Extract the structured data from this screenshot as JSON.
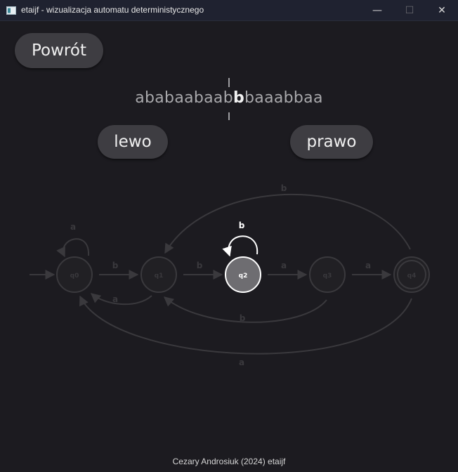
{
  "window": {
    "title": "etaijf - wizualizacja automatu deterministycznego",
    "minimize_glyph": "—",
    "maximize_glyph": "☐",
    "close_glyph": "✕"
  },
  "toolbar": {
    "back_label": "Powrót",
    "left_label": "lewo",
    "right_label": "prawo"
  },
  "tape": {
    "before": "ababaabaab",
    "current": "b",
    "after": "baaabbaa"
  },
  "automaton": {
    "states": [
      "q0",
      "q1",
      "q2",
      "q3",
      "q4"
    ],
    "current_state": "q2",
    "accepting_states": [
      "q4"
    ],
    "start_state": "q0",
    "transitions": [
      {
        "from": "q0",
        "to": "q0",
        "symbol": "a"
      },
      {
        "from": "q0",
        "to": "q1",
        "symbol": "b"
      },
      {
        "from": "q1",
        "to": "q0",
        "symbol": "a"
      },
      {
        "from": "q1",
        "to": "q2",
        "symbol": "b"
      },
      {
        "from": "q2",
        "to": "q2",
        "symbol": "b"
      },
      {
        "from": "q2",
        "to": "q3",
        "symbol": "a"
      },
      {
        "from": "q3",
        "to": "q1",
        "symbol": "b"
      },
      {
        "from": "q3",
        "to": "q4",
        "symbol": "a"
      },
      {
        "from": "q4",
        "to": "q1",
        "symbol": "b"
      },
      {
        "from": "q4",
        "to": "q0",
        "symbol": "a"
      }
    ]
  },
  "colors": {
    "background": "#1c1b20",
    "inactive": "#3a393d",
    "active": "#ffffff",
    "active_fill": "#6e6d71"
  },
  "footer": {
    "text": "Cezary Androsiuk (2024) etaijf"
  }
}
